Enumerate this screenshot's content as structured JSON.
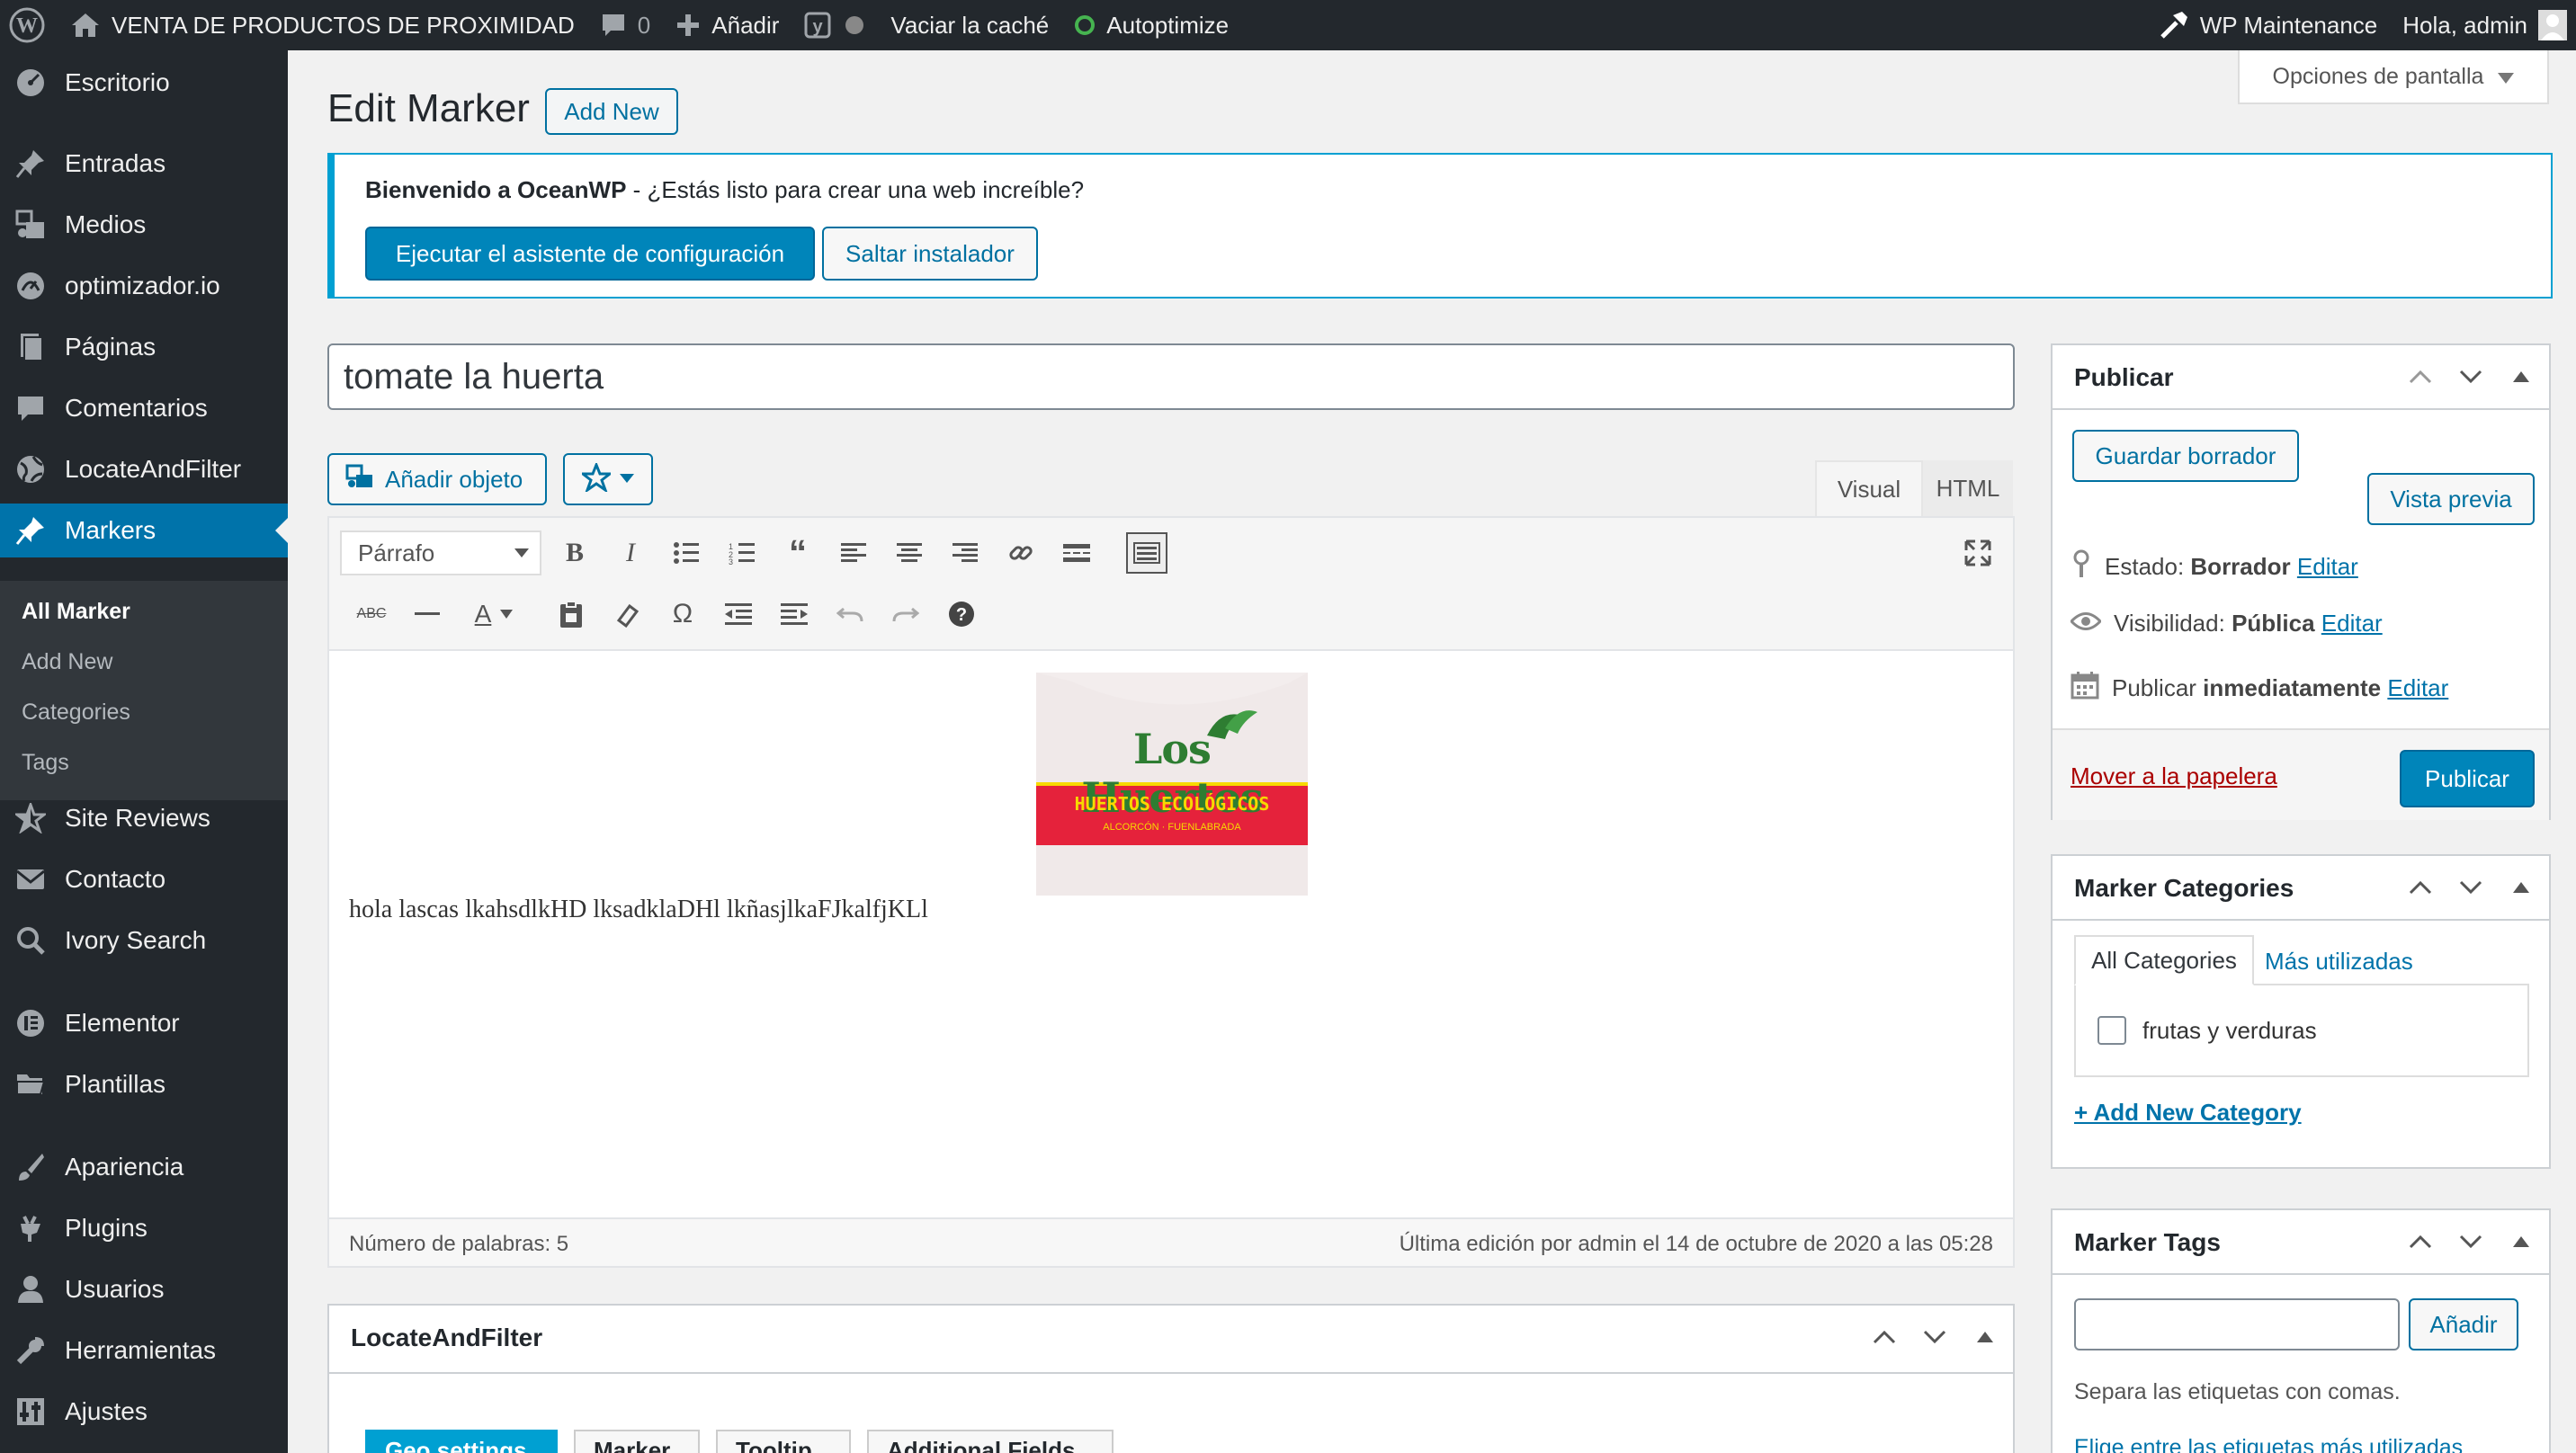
{
  "adminbar": {
    "site_name": "VENTA DE PRODUCTOS DE PROXIMIDAD",
    "comments_count": "0",
    "add_label": "Añadir",
    "cache_label": "Vaciar la caché",
    "autoptimize_label": "Autoptimize",
    "maintenance_label": "WP Maintenance",
    "greeting": "Hola, admin"
  },
  "sidebar": {
    "items": [
      {
        "label": "Escritorio",
        "icon": "dashboard-icon"
      },
      {
        "label": "Entradas",
        "icon": "pin-icon"
      },
      {
        "label": "Medios",
        "icon": "media-icon"
      },
      {
        "label": "optimizador.io",
        "icon": "gauge-icon"
      },
      {
        "label": "Páginas",
        "icon": "pages-icon"
      },
      {
        "label": "Comentarios",
        "icon": "comment-icon"
      },
      {
        "label": "LocateAndFilter",
        "icon": "globe-icon"
      },
      {
        "label": "Markers",
        "icon": "pin-icon"
      },
      {
        "label": "Site Reviews",
        "icon": "star-icon"
      },
      {
        "label": "Contacto",
        "icon": "mail-icon"
      },
      {
        "label": "Ivory Search",
        "icon": "search-icon"
      },
      {
        "label": "Elementor",
        "icon": "elementor-icon"
      },
      {
        "label": "Plantillas",
        "icon": "folder-icon"
      },
      {
        "label": "Apariencia",
        "icon": "brush-icon"
      },
      {
        "label": "Plugins",
        "icon": "plug-icon"
      },
      {
        "label": "Usuarios",
        "icon": "user-icon"
      },
      {
        "label": "Herramientas",
        "icon": "wrench-icon"
      },
      {
        "label": "Ajustes",
        "icon": "settings-icon"
      }
    ],
    "submenu": [
      "All Marker",
      "Add New",
      "Categories",
      "Tags"
    ]
  },
  "screen_options": "Opciones de pantalla",
  "heading": {
    "title": "Edit Marker",
    "add_new": "Add New"
  },
  "notice": {
    "bold": "Bienvenido a OceanWP",
    "text": " - ¿Estás listo para crear una web increíble?",
    "primary_btn": "Ejecutar el asistente de configuración",
    "secondary_btn": "Saltar instalador"
  },
  "post_title": "tomate la huerta",
  "editor": {
    "add_media": "Añadir objeto",
    "tab_visual": "Visual",
    "tab_html": "HTML",
    "format": "Párrafo",
    "content": "hola lascas lkahsdlkHD lksadklaDHl lkñasjlkaFJkalfjKLl",
    "logo_text": "Los Huertos",
    "logo_sub": "HUERTOS ECOLÓGICOS",
    "logo_small": "ALCORCÓN · FUENLABRADA",
    "word_count": "Número de palabras: 5",
    "last_edit": "Última edición por admin el 14 de octubre de 2020 a las 05:28"
  },
  "locate_box": {
    "title": "LocateAndFilter",
    "tabs": [
      "Geo settings",
      "Marker",
      "Tooltip",
      "Additional Fields"
    ]
  },
  "publish": {
    "title": "Publicar",
    "save_draft": "Guardar borrador",
    "preview": "Vista previa",
    "status_label": "Estado:",
    "status_value": "Borrador",
    "visibility_label": "Visibilidad:",
    "visibility_value": "Pública",
    "schedule_label": "Publicar",
    "schedule_value": "inmediatamente",
    "edit": "Editar",
    "trash": "Mover a la papelera",
    "publish_btn": "Publicar"
  },
  "categories": {
    "title": "Marker Categories",
    "tab_all": "All Categories",
    "tab_popular": "Más utilizadas",
    "item": "frutas y verduras",
    "add_new": "+ Add New Category"
  },
  "tags": {
    "title": "Marker Tags",
    "add_btn": "Añadir",
    "hint": "Separa las etiquetas con comas.",
    "choose": "Elige entre las etiquetas más utilizadas"
  },
  "colors": {
    "accent": "#0073aa",
    "primary_button": "#0085ba",
    "adminbar": "#23282d",
    "trash": "#a00"
  }
}
